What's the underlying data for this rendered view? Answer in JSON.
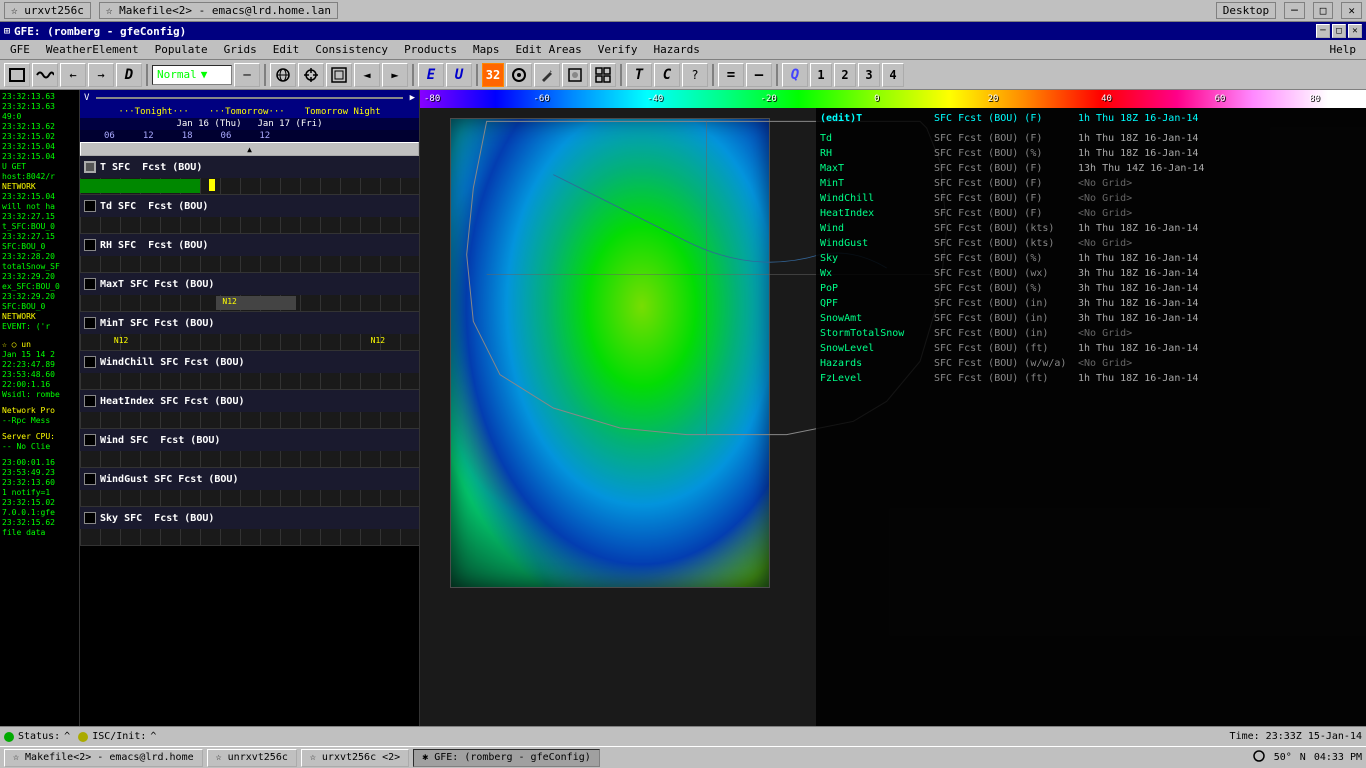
{
  "titlebar": {
    "title": "GFE: (romberg - gfeConfig)",
    "icon": "⊞"
  },
  "taskbar_top": {
    "items": [
      {
        "label": "☆ urxvt256c",
        "active": false,
        "id": "urxvt1"
      },
      {
        "label": "☆ Makefile<2> - emacs@lrd.home.lan",
        "active": false,
        "id": "emacs"
      },
      {
        "label": "Desktop",
        "active": false,
        "id": "desktop"
      }
    ]
  },
  "menu": {
    "items": [
      {
        "label": "GFE"
      },
      {
        "label": "WeatherElement"
      },
      {
        "label": "Populate"
      },
      {
        "label": "Grids"
      },
      {
        "label": "Edit"
      },
      {
        "label": "Consistency"
      },
      {
        "label": "Products"
      },
      {
        "label": "Maps"
      },
      {
        "label": "Edit Areas"
      },
      {
        "label": "Verify"
      },
      {
        "label": "Hazards"
      },
      {
        "label": "Help"
      }
    ]
  },
  "toolbar": {
    "mode_label": "Normal",
    "arrow_left": "←",
    "arrow_right": "→",
    "arrow_left2": "«",
    "arrow_right2": "»",
    "btn_d": "D",
    "btn_globe": "🌐",
    "btn_cross": "✕",
    "btn_frame": "□",
    "btn_prev": "◄",
    "btn_next": "►",
    "btn_e": "E",
    "btn_u": "U",
    "btn_32": "32",
    "btn_circle": "⊙",
    "btn_pencil": "✎",
    "btn_special": "⊛",
    "btn_grid": "⊞",
    "btn_T": "T",
    "btn_C": "C",
    "btn_question": "?",
    "btn_equals": "=",
    "btn_minus": "—",
    "btn_Q": "Q",
    "btn_1": "1",
    "btn_2": "2",
    "btn_3": "3",
    "btn_4": "4"
  },
  "timeline": {
    "date_row1": "Tonight",
    "date_row2": "Tomorrow",
    "date_row3": "Tomorrow Night",
    "date_jan16": "Jan 16 (Thu)",
    "date_jan17": "Jan 17 (Fri)",
    "hours": [
      "06",
      "12",
      "18",
      "06",
      "12"
    ]
  },
  "weather_elements": [
    {
      "id": "T",
      "label": "T SFC Fcst (BOU)",
      "active": true,
      "has_grid": true
    },
    {
      "id": "Td",
      "label": "Td SFC Fcst (BOU)",
      "active": false,
      "has_grid": false
    },
    {
      "id": "RH",
      "label": "RH SFC Fcst (BOU)",
      "active": false,
      "has_grid": false
    },
    {
      "id": "MaxT",
      "label": "MaxT SFC Fcst (BOU)",
      "active": false,
      "has_grid": true,
      "n12_left": true
    },
    {
      "id": "MinT",
      "label": "MinT SFC Fcst (BOU)",
      "active": false,
      "has_grid": true,
      "n12_both": true
    },
    {
      "id": "WindChill",
      "label": "WindChill SFC Fcst (BOU)",
      "active": false,
      "has_grid": false
    },
    {
      "id": "HeatIndex",
      "label": "HeatIndex SFC Fcst (BOU)",
      "active": false,
      "has_grid": false
    },
    {
      "id": "Wind",
      "label": "Wind SFC Fcst (BOU)",
      "active": false,
      "has_grid": false
    },
    {
      "id": "WindGust",
      "label": "WindGust SFC Fcst (BOU)",
      "active": false,
      "has_grid": false
    },
    {
      "id": "Sky",
      "label": "Sky SFC Fcst (BOU)",
      "active": false,
      "has_grid": false
    }
  ],
  "color_scale": {
    "label": "-80",
    "markers": [
      "-60",
      "-40",
      "-20",
      "0",
      "20",
      "40",
      "60",
      "80"
    ]
  },
  "info_panel": {
    "active_element": "(edit)T",
    "active_detail": "SFC Fcst (BOU) (F)",
    "active_time": "1h Thu 18Z 16-Jan-14",
    "rows": [
      {
        "name": "Td",
        "type": "SFC Fcst (BOU) (F)",
        "time": "1h Thu 18Z 16-Jan-14"
      },
      {
        "name": "RH",
        "type": "SFC Fcst (BOU) (%)",
        "time": "1h Thu 18Z 16-Jan-14"
      },
      {
        "name": "MaxT",
        "type": "SFC Fcst (BOU) (F)",
        "time": "13h Thu 14Z 16-Jan-14"
      },
      {
        "name": "MinT",
        "type": "SFC Fcst (BOU) (F)",
        "time": "<No Grid>"
      },
      {
        "name": "WindChill",
        "type": "SFC Fcst (BOU) (F)",
        "time": "<No Grid>"
      },
      {
        "name": "HeatIndex",
        "type": "SFC Fcst (BOU) (F)",
        "time": "<No Grid>"
      },
      {
        "name": "Wind",
        "type": "SFC Fcst (BOU) (kts)",
        "time": "1h Thu 18Z 16-Jan-14"
      },
      {
        "name": "WindGust",
        "type": "SFC Fcst (BOU) (kts)",
        "time": "<No Grid>"
      },
      {
        "name": "Sky",
        "type": "SFC Fcst (BOU) (%)",
        "time": "1h Thu 18Z 16-Jan-14"
      },
      {
        "name": "Wx",
        "type": "SFC Fcst (BOU) (wx)",
        "time": "3h Thu 18Z 16-Jan-14"
      },
      {
        "name": "PoP",
        "type": "SFC Fcst (BOU) (%)",
        "time": "3h Thu 18Z 16-Jan-14"
      },
      {
        "name": "QPF",
        "type": "SFC Fcst (BOU) (in)",
        "time": "3h Thu 18Z 16-Jan-14"
      },
      {
        "name": "SnowAmt",
        "type": "SFC Fcst (BOU) (in)",
        "time": "3h Thu 18Z 16-Jan-14"
      },
      {
        "name": "StormTotalSnow",
        "type": "SFC Fcst (BOU) (in)",
        "time": "<No Grid>"
      },
      {
        "name": "SnowLevel",
        "type": "SFC Fcst (BOU) (ft)",
        "time": "1h Thu 18Z 16-Jan-14"
      },
      {
        "name": "Hazards",
        "type": "SFC Fcst (BOU) (w/w/a)",
        "time": "<No Grid>"
      },
      {
        "name": "FzLevel",
        "type": "SFC Fcst (BOU) (ft)",
        "time": "1h Thu 18Z 16-Jan-14"
      }
    ]
  },
  "log_lines": [
    "23:32:13.63",
    "23:32:13.63",
    "49:0",
    "23:32:13.62",
    "23:32:15.02",
    "23:32:15.04",
    "23:32:15.04",
    "23:32:15.04",
    "U GET",
    "host:8042/r",
    "NETWORK",
    "23:32:15.04",
    "will not ha",
    "23:32:27.15",
    "23:32:27.15",
    "t_SFC:BOU_0",
    "23:32:27.15",
    "SFC:BOU_0",
    "23:32:28.20",
    "totalSnow_SF",
    "23:32:29.20",
    "ex_SFC:BOU_0",
    "23:32:29.20",
    "SFC:BOU_0",
    "NETWORK",
    "EVENT: ('r"
  ],
  "status_bar": {
    "status_label": "Status:",
    "isc_label": "ISC/Init:",
    "time_label": "Time: 23:33Z 15-Jan-14"
  },
  "bottom_taskbar": {
    "items": [
      {
        "label": "☆ Makefile<2> - emacs@lrd.home",
        "active": false
      },
      {
        "label": "☆ unrxvt256c",
        "active": false
      },
      {
        "label": "☆ urxvt256c <2>",
        "active": false
      },
      {
        "label": "✱ GFE: (romberg - gfeConfig)",
        "active": true
      }
    ],
    "right_icons": [
      "50°",
      "N",
      "04:33 PM"
    ]
  }
}
